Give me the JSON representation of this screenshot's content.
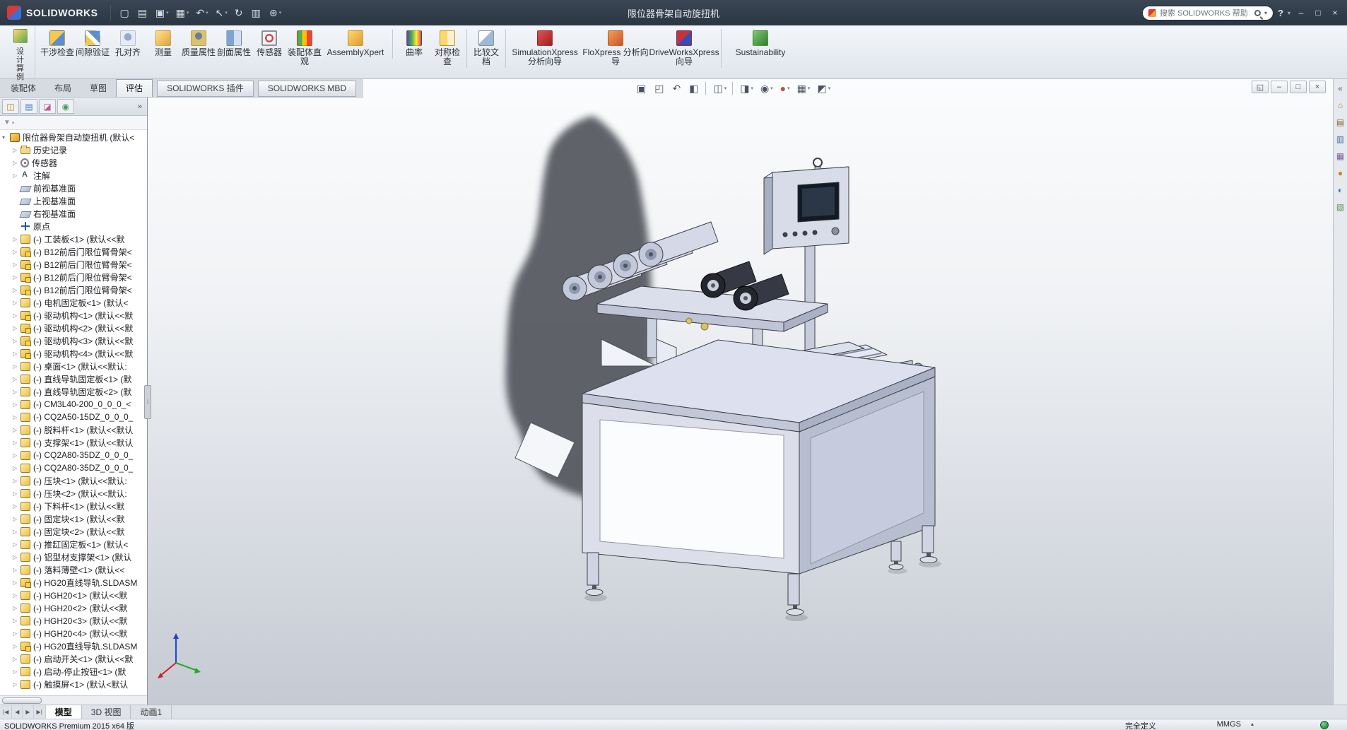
{
  "title_bar": {
    "app_name": "SOLIDWORKS",
    "document_title": "限位器骨架自动旋扭机",
    "quick_tools": [
      {
        "glyph": "▢",
        "icon": "new-document-icon",
        "arrow": ""
      },
      {
        "glyph": "▤",
        "icon": "open-icon",
        "arrow": ""
      },
      {
        "glyph": "▣",
        "icon": "save-icon",
        "arrow": "▾"
      },
      {
        "glyph": "▦",
        "icon": "print-icon",
        "arrow": "▾"
      },
      {
        "glyph": "↶",
        "icon": "undo-icon",
        "arrow": "▾"
      },
      {
        "glyph": "↖",
        "icon": "select-icon",
        "arrow": "▾"
      },
      {
        "glyph": "↻",
        "icon": "rebuild-icon",
        "arrow": ""
      },
      {
        "glyph": "▥",
        "icon": "file-properties-icon",
        "arrow": ""
      },
      {
        "glyph": "⊛",
        "icon": "options-icon",
        "arrow": "▾"
      }
    ],
    "search": {
      "placeholder": "搜索 SOLIDWORKS 帮助",
      "dropdown": "▾"
    },
    "help_glyph": "?",
    "help_dropdown": "▾",
    "window_controls": [
      {
        "glyph": "–",
        "icon": "minimize-button"
      },
      {
        "glyph": "□",
        "icon": "restore-button"
      },
      {
        "glyph": "×",
        "icon": "close-button"
      }
    ]
  },
  "ribbon": {
    "design_study": {
      "label": "设计算例",
      "arrow": "▾"
    },
    "buttons": [
      {
        "label": "干涉检查",
        "icon": "ric-interference",
        "cls": ""
      },
      {
        "label": "间隙验证",
        "icon": "ric-clearance",
        "cls": ""
      },
      {
        "label": "孔对齐",
        "icon": "ric-hole",
        "cls": ""
      },
      {
        "label": "测量",
        "icon": "ric-measure",
        "cls": ""
      },
      {
        "label": "质量属性",
        "icon": "ric-mass",
        "cls": ""
      },
      {
        "label": "剖面属性",
        "icon": "ric-sectionprop",
        "cls": ""
      },
      {
        "label": "传感器",
        "icon": "ric-sensor",
        "cls": ""
      },
      {
        "label": "装配体直观",
        "icon": "ric-visualize",
        "cls": ""
      },
      {
        "label": "AssemblyXpert",
        "icon": "ric-axpert",
        "cls": "wide sep-after"
      },
      {
        "label": "曲率",
        "icon": "ric-curvature",
        "cls": ""
      },
      {
        "label": "对称检查",
        "icon": "ric-symmetry",
        "cls": "sep-after"
      },
      {
        "label": "比较文档",
        "icon": "ric-compare",
        "cls": "sep-after"
      },
      {
        "label": "SimulationXpress 分析向导",
        "icon": "ric-simx",
        "cls": "wide"
      },
      {
        "label": "FloXpress 分析向导",
        "icon": "ric-flox",
        "cls": "wide"
      },
      {
        "label": "DriveWorksXpress 向导",
        "icon": "ric-dwx",
        "cls": "wide sep-after"
      },
      {
        "label": "Sustainability",
        "icon": "ric-sust",
        "cls": "wide"
      }
    ]
  },
  "command_tabs": [
    {
      "label": "装配体",
      "cls": ""
    },
    {
      "label": "布局",
      "cls": ""
    },
    {
      "label": "草图",
      "cls": ""
    },
    {
      "label": "评估",
      "cls": "active"
    },
    {
      "label": "SOLIDWORKS 插件",
      "cls": "addin"
    },
    {
      "label": "SOLIDWORKS MBD",
      "cls": "addin"
    }
  ],
  "feature_tree": {
    "panel_tabs": [
      {
        "glyph": "◫",
        "color": "#b8860b",
        "icon": "featuremanager-tab-icon"
      },
      {
        "glyph": "▤",
        "color": "#3f7fbf",
        "icon": "propertymanager-tab-icon"
      },
      {
        "glyph": "◪",
        "color": "#c05a8e",
        "icon": "configurationmanager-tab-icon"
      },
      {
        "glyph": "◉",
        "color": "#4b9e5f",
        "icon": "displaymanager-tab-icon"
      }
    ],
    "overflow": "»",
    "filter_glyph": "▼",
    "filter_dropdown": "▾",
    "items": [
      {
        "label": "限位器骨架自动旋扭机 (默认<",
        "icon": "ic-asmtop",
        "arrow": "▾",
        "cls": "root"
      },
      {
        "label": "历史记录",
        "icon": "ic-hist",
        "arrow": "▷",
        "cls": ""
      },
      {
        "label": "传感器",
        "icon": "ic-sensor",
        "arrow": "▷",
        "cls": ""
      },
      {
        "label": "注解",
        "icon": "ic-annot",
        "arrow": "▷",
        "cls": ""
      },
      {
        "label": "前视基准面",
        "icon": "ic-plane",
        "arrow": "",
        "cls": ""
      },
      {
        "label": "上视基准面",
        "icon": "ic-plane",
        "arrow": "",
        "cls": ""
      },
      {
        "label": "右视基准面",
        "icon": "ic-plane",
        "arrow": "",
        "cls": ""
      },
      {
        "label": "原点",
        "icon": "ic-origin",
        "arrow": "",
        "cls": ""
      },
      {
        "label": "(-) 工装板<1> (默认<<默",
        "icon": "ic-part",
        "arrow": "▷",
        "cls": ""
      },
      {
        "label": "(-) B12前后门限位臂骨架<",
        "icon": "ic-asm",
        "arrow": "▷",
        "cls": ""
      },
      {
        "label": "(-) B12前后门限位臂骨架<",
        "icon": "ic-asm",
        "arrow": "▷",
        "cls": ""
      },
      {
        "label": "(-) B12前后门限位臂骨架<",
        "icon": "ic-asm",
        "arrow": "▷",
        "cls": ""
      },
      {
        "label": "(-) B12前后门限位臂骨架<",
        "icon": "ic-asm",
        "arrow": "▷",
        "cls": ""
      },
      {
        "label": "(-) 电机固定板<1> (默认<",
        "icon": "ic-part",
        "arrow": "▷",
        "cls": ""
      },
      {
        "label": "(-) 驱动机构<1> (默认<<默",
        "icon": "ic-asm",
        "arrow": "▷",
        "cls": ""
      },
      {
        "label": "(-) 驱动机构<2> (默认<<默",
        "icon": "ic-asm",
        "arrow": "▷",
        "cls": ""
      },
      {
        "label": "(-) 驱动机构<3> (默认<<默",
        "icon": "ic-asm",
        "arrow": "▷",
        "cls": ""
      },
      {
        "label": "(-) 驱动机构<4> (默认<<默",
        "icon": "ic-asm",
        "arrow": "▷",
        "cls": ""
      },
      {
        "label": "(-) 桌面<1> (默认<<默认:",
        "icon": "ic-part",
        "arrow": "▷",
        "cls": ""
      },
      {
        "label": "(-) 直线导轨固定板<1> (默",
        "icon": "ic-part",
        "arrow": "▷",
        "cls": ""
      },
      {
        "label": "(-) 直线导轨固定板<2> (默",
        "icon": "ic-part",
        "arrow": "▷",
        "cls": ""
      },
      {
        "label": "(-) CM3L40-200_0_0_0_<",
        "icon": "ic-part",
        "arrow": "▷",
        "cls": ""
      },
      {
        "label": "(-) CQ2A50-15DZ_0_0_0_",
        "icon": "ic-part",
        "arrow": "▷",
        "cls": ""
      },
      {
        "label": "(-) 脱料杆<1> (默认<<默认",
        "icon": "ic-part",
        "arrow": "▷",
        "cls": ""
      },
      {
        "label": "(-) 支撑架<1> (默认<<默认",
        "icon": "ic-part",
        "arrow": "▷",
        "cls": ""
      },
      {
        "label": "(-) CQ2A80-35DZ_0_0_0_",
        "icon": "ic-part",
        "arrow": "▷",
        "cls": ""
      },
      {
        "label": "(-) CQ2A80-35DZ_0_0_0_",
        "icon": "ic-part",
        "arrow": "▷",
        "cls": ""
      },
      {
        "label": "(-) 压块<1> (默认<<默认:",
        "icon": "ic-part",
        "arrow": "▷",
        "cls": ""
      },
      {
        "label": "(-) 压块<2> (默认<<默认:",
        "icon": "ic-part",
        "arrow": "▷",
        "cls": ""
      },
      {
        "label": "(-) 下料杆<1> (默认<<默",
        "icon": "ic-part",
        "arrow": "▷",
        "cls": ""
      },
      {
        "label": "(-) 固定块<1> (默认<<默",
        "icon": "ic-part",
        "arrow": "▷",
        "cls": ""
      },
      {
        "label": "(-) 固定块<2> (默认<<默",
        "icon": "ic-part",
        "arrow": "▷",
        "cls": ""
      },
      {
        "label": "(-) 推缸固定板<1> (默认<",
        "icon": "ic-part",
        "arrow": "▷",
        "cls": ""
      },
      {
        "label": "(-) 铝型材支撑架<1> (默认",
        "icon": "ic-part",
        "arrow": "▷",
        "cls": ""
      },
      {
        "label": "(-) 落料薄壁<1> (默认<<",
        "icon": "ic-part",
        "arrow": "▷",
        "cls": ""
      },
      {
        "label": "(-) HG20直线导轨.SLDASM",
        "icon": "ic-asm",
        "arrow": "▷",
        "cls": ""
      },
      {
        "label": "(-) HGH20<1> (默认<<默",
        "icon": "ic-part",
        "arrow": "▷",
        "cls": ""
      },
      {
        "label": "(-) HGH20<2> (默认<<默",
        "icon": "ic-part",
        "arrow": "▷",
        "cls": ""
      },
      {
        "label": "(-) HGH20<3> (默认<<默",
        "icon": "ic-part",
        "arrow": "▷",
        "cls": ""
      },
      {
        "label": "(-) HGH20<4> (默认<<默",
        "icon": "ic-part",
        "arrow": "▷",
        "cls": ""
      },
      {
        "label": "(-) HG20直线导轨.SLDASM",
        "icon": "ic-asm",
        "arrow": "▷",
        "cls": ""
      },
      {
        "label": "(-) 启动开关<1> (默认<<默",
        "icon": "ic-part",
        "arrow": "▷",
        "cls": ""
      },
      {
        "label": "(-) 启动-停止按钮<1> (默",
        "icon": "ic-part",
        "arrow": "▷",
        "cls": ""
      },
      {
        "label": "(-) 触摸屏<1> (默认<默认",
        "icon": "ic-part",
        "arrow": "▷",
        "cls": ""
      }
    ]
  },
  "viewport": {
    "headsup": [
      {
        "glyph": "▣",
        "icon": "zoom-fit-icon",
        "arrow": "",
        "cls": "",
        "color": "#4a5260"
      },
      {
        "glyph": "◰",
        "icon": "zoom-area-icon",
        "arrow": "",
        "cls": "",
        "color": "#4a5260"
      },
      {
        "glyph": "↶",
        "icon": "previous-view-icon",
        "arrow": "",
        "cls": "",
        "color": "#4a5260"
      },
      {
        "glyph": "◧",
        "icon": "section-view-icon",
        "arrow": "",
        "cls": "divafter",
        "color": "#4a5260"
      },
      {
        "glyph": "◫",
        "icon": "view-orientation-icon",
        "arrow": "▾",
        "cls": "divafter",
        "color": "#4a5260"
      },
      {
        "glyph": "◨",
        "icon": "display-style-icon",
        "arrow": "▾",
        "cls": "",
        "color": "#4a5260"
      },
      {
        "glyph": "◉",
        "icon": "hide-show-icon",
        "arrow": "▾",
        "cls": "",
        "color": "#4a5260"
      },
      {
        "glyph": "●",
        "icon": "edit-appearance-icon",
        "arrow": "▾",
        "cls": "",
        "color": "#b85440"
      },
      {
        "glyph": "▦",
        "icon": "apply-scene-icon",
        "arrow": "▾",
        "cls": "",
        "color": "#4a5260"
      },
      {
        "glyph": "◩",
        "icon": "view-settings-icon",
        "arrow": "▾",
        "cls": "",
        "color": "#4a5260"
      }
    ],
    "window_controls": [
      {
        "glyph": "◱",
        "icon": "doc-restore-icon"
      },
      {
        "glyph": "–",
        "icon": "doc-minimize-icon"
      },
      {
        "glyph": "□",
        "icon": "doc-maximize-icon"
      },
      {
        "glyph": "×",
        "icon": "doc-close-icon"
      }
    ]
  },
  "task_pane": {
    "collapse_glyph": "«",
    "icons": [
      {
        "glyph": "⌂",
        "color": "#b8872f",
        "icon": "resources-icon"
      },
      {
        "glyph": "▤",
        "color": "#8a6d2f",
        "icon": "design-library-icon"
      },
      {
        "glyph": "▥",
        "color": "#4a6fa0",
        "icon": "file-explorer-icon"
      },
      {
        "glyph": "▦",
        "color": "#7a5fa0",
        "icon": "view-palette-icon"
      },
      {
        "glyph": "●",
        "color": "#d08030",
        "icon": "appearances-icon"
      },
      {
        "glyph": "◐",
        "color": "#3f6fbf",
        "icon": "scenes-icon"
      },
      {
        "glyph": "▧",
        "color": "#5f8f5f",
        "icon": "custom-properties-icon"
      }
    ]
  },
  "document_tabs": {
    "nav": [
      "|◀",
      "◀",
      "▶",
      "▶|"
    ],
    "tabs": [
      {
        "label": "模型",
        "cls": "active"
      },
      {
        "label": "3D 视图",
        "cls": ""
      },
      {
        "label": "动画1",
        "cls": ""
      }
    ]
  },
  "status_bar": {
    "left": "SOLIDWORKS Premium 2015 x64 版",
    "define_state": "完全定义",
    "units": "MMGS",
    "units_arrow": "▴"
  }
}
